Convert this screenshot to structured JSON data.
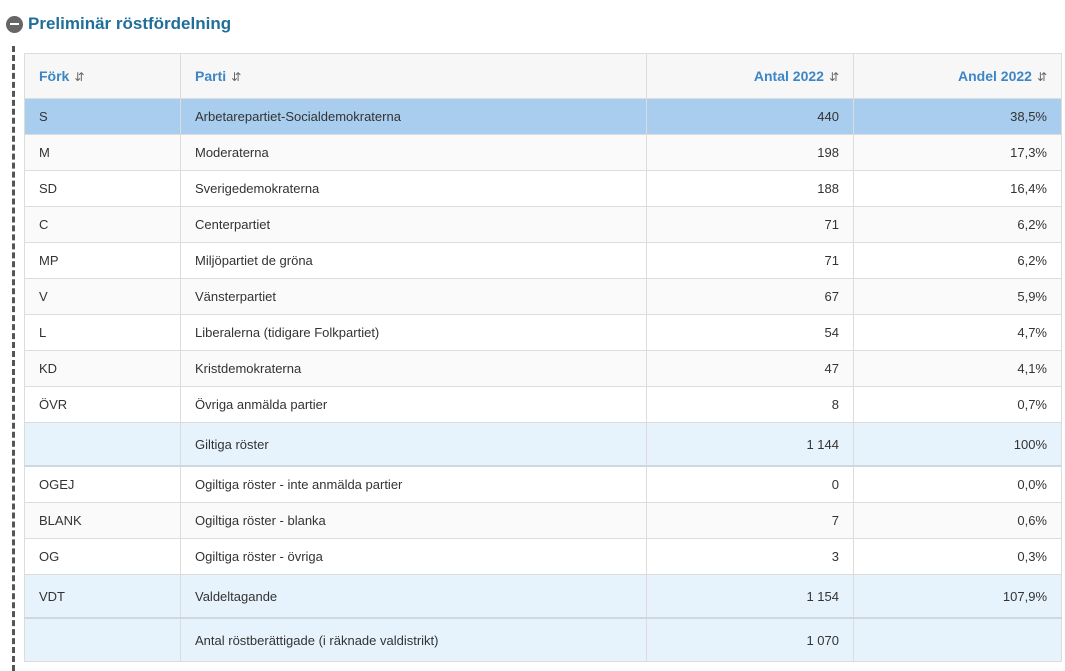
{
  "section": {
    "title": "Preliminär röstfördelning",
    "icon": "minus-circle-icon"
  },
  "table": {
    "headers": [
      "Förk",
      "Parti",
      "Antal 2022",
      "Andel 2022"
    ],
    "sort_glyph": "⇵",
    "rows": [
      {
        "abbr": "S",
        "party": "Arbetarepartiet-Socialdemokraterna",
        "count": "440",
        "share": "38,5%"
      },
      {
        "abbr": "M",
        "party": "Moderaterna",
        "count": "198",
        "share": "17,3%"
      },
      {
        "abbr": "SD",
        "party": "Sverigedemokraterna",
        "count": "188",
        "share": "16,4%"
      },
      {
        "abbr": "C",
        "party": "Centerpartiet",
        "count": "71",
        "share": "6,2%"
      },
      {
        "abbr": "MP",
        "party": "Miljöpartiet de gröna",
        "count": "71",
        "share": "6,2%"
      },
      {
        "abbr": "V",
        "party": "Vänsterpartiet",
        "count": "67",
        "share": "5,9%"
      },
      {
        "abbr": "L",
        "party": "Liberalerna (tidigare Folkpartiet)",
        "count": "54",
        "share": "4,7%"
      },
      {
        "abbr": "KD",
        "party": "Kristdemokraterna",
        "count": "47",
        "share": "4,1%"
      },
      {
        "abbr": "ÖVR",
        "party": "Övriga anmälda partier",
        "count": "8",
        "share": "0,7%"
      }
    ],
    "valid": {
      "abbr": "",
      "party": "Giltiga röster",
      "count": "1 144",
      "share": "100%"
    },
    "invalid_rows": [
      {
        "abbr": "OGEJ",
        "party": "Ogiltiga röster - inte anmälda partier",
        "count": "0",
        "share": "0,0%"
      },
      {
        "abbr": "BLANK",
        "party": "Ogiltiga röster - blanka",
        "count": "7",
        "share": "0,6%"
      },
      {
        "abbr": "OG",
        "party": "Ogiltiga röster - övriga",
        "count": "3",
        "share": "0,3%"
      }
    ],
    "turnout": {
      "abbr": "VDT",
      "party": "Valdeltagande",
      "count": "1 154",
      "share": "107,9%"
    },
    "eligible": {
      "abbr": "",
      "party": "Antal röstberättigade (i räknade valdistrikt)",
      "count": "1 070",
      "share": ""
    }
  }
}
